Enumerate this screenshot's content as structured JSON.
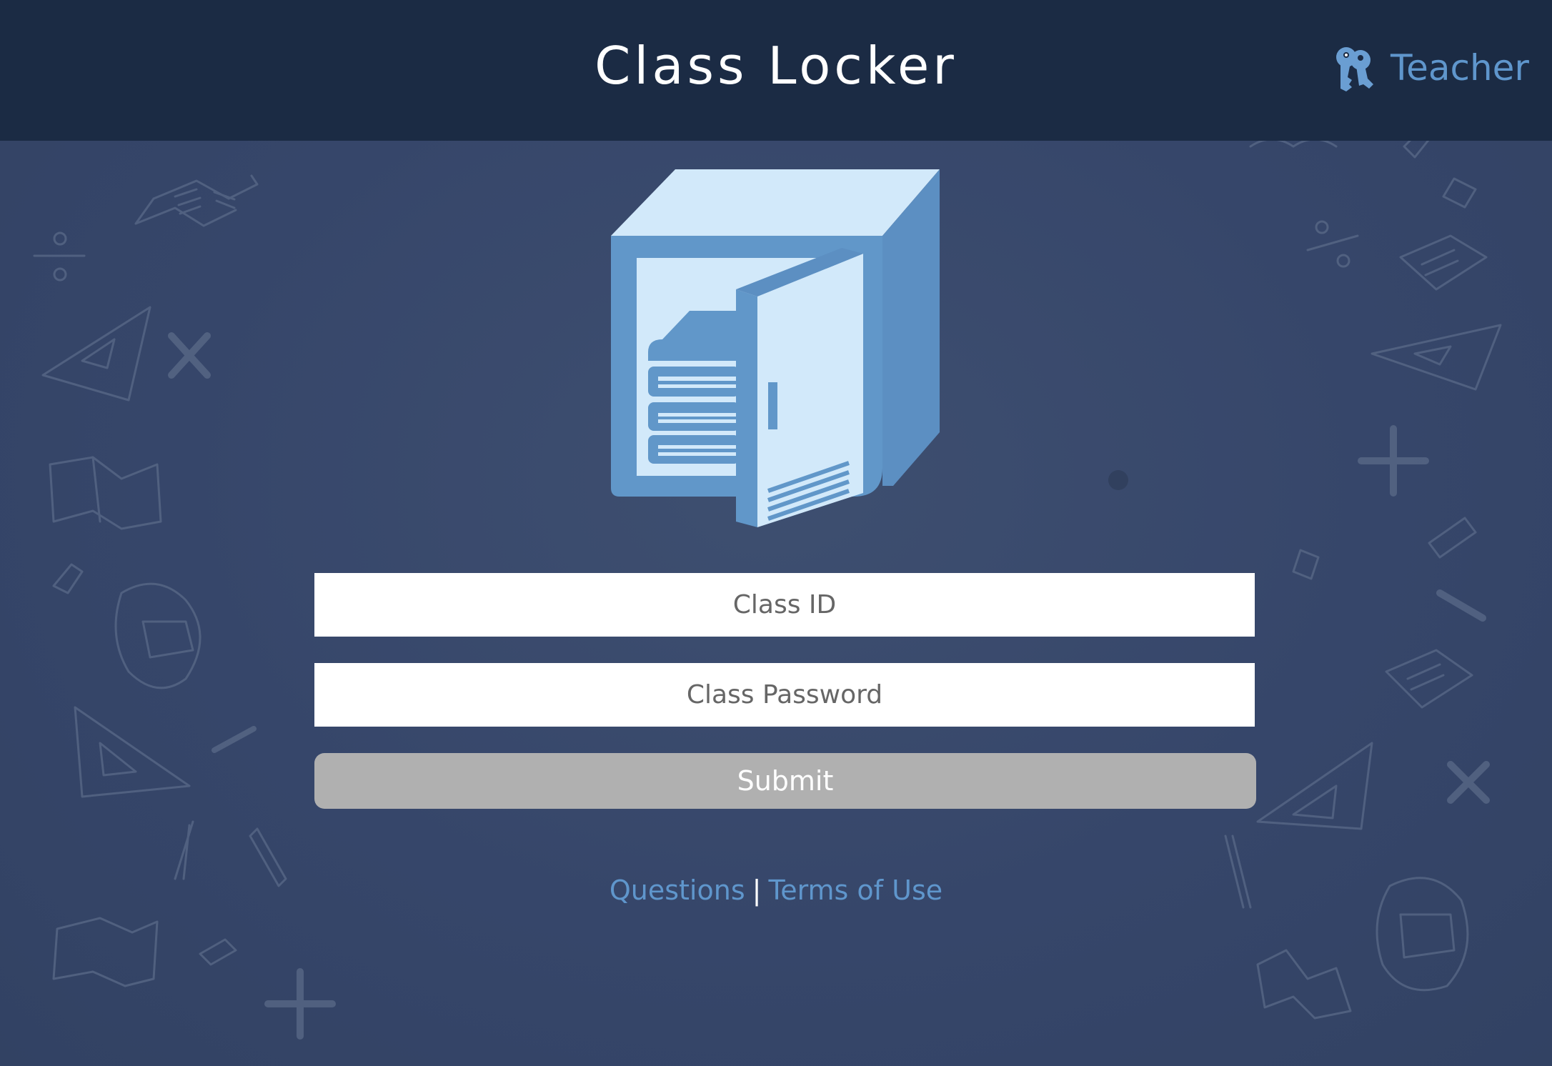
{
  "header": {
    "title": "Class Locker",
    "teacher_link": "Teacher",
    "teacher_icon": "keys-icon"
  },
  "logo": {
    "icon": "locker-with-books-icon",
    "colors": {
      "light": "#d2e9fa",
      "mid": "#6197c9",
      "dark": "#5c8fc2"
    }
  },
  "form": {
    "class_id_placeholder": "Class ID",
    "class_id_value": "",
    "class_password_placeholder": "Class Password",
    "class_password_value": "",
    "submit_label": "Submit"
  },
  "footer": {
    "questions_label": "Questions",
    "separator": "|",
    "terms_label": "Terms of Use"
  },
  "colors": {
    "header_bg": "#1b2b44",
    "page_bg": "#3b4b6a",
    "link": "#5f96cc",
    "button_bg": "#b0b0b0"
  }
}
